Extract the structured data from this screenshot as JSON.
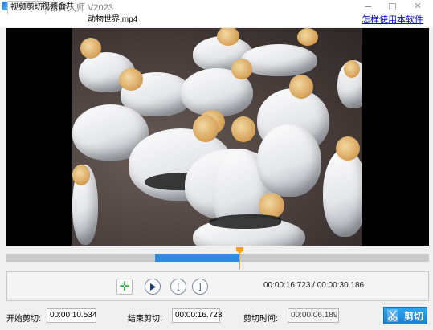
{
  "window": {
    "title": "视频剪切合并大师 V2023",
    "minimize_icon": "minimize-icon",
    "maximize_icon": "maximize-icon",
    "close_label": "✕"
  },
  "tabs": [
    {
      "label": "视频剪切",
      "active": true
    },
    {
      "label": "视频合并",
      "active": false
    }
  ],
  "file": {
    "name": "动物世界.mp4"
  },
  "help": {
    "label": "怎样使用本软件"
  },
  "player": {
    "timecode": "00:00:16.723 / 00:00:30.186",
    "selection_start_fraction": 0.349,
    "selection_end_fraction": 0.554,
    "playhead_fraction": 0.554,
    "accent_color": "#2d8ae0",
    "playhead_color": "#f3a21b"
  },
  "controls": {
    "add_icon": "plus-icon",
    "play_icon": "play-icon",
    "mark_in_label": "[",
    "mark_out_label": "]"
  },
  "cut": {
    "start_label": "开始剪切:",
    "start_value": "00:00:10.534",
    "end_label": "结束剪切:",
    "end_value": "00:00:16.723",
    "duration_label": "剪切时间:",
    "duration_value": "00:00:06.189",
    "button_label": "剪切"
  }
}
